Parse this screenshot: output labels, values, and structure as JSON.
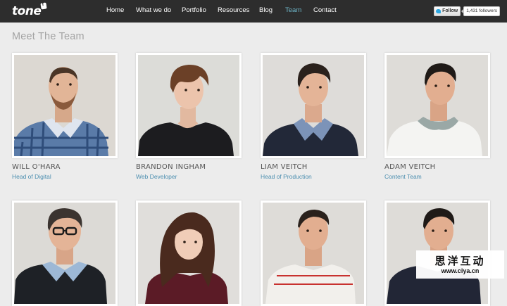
{
  "header": {
    "logo_text": "tone",
    "logo_mark": "f",
    "nav": [
      {
        "label": "Home",
        "active": false
      },
      {
        "label": "What we do",
        "active": false
      },
      {
        "label": "Portfolio",
        "active": false
      },
      {
        "label": "Resources",
        "active": false
      },
      {
        "label": "Blog",
        "active": false
      },
      {
        "label": "Team",
        "active": true
      },
      {
        "label": "Contact",
        "active": false
      }
    ],
    "twitter": {
      "follow_label": "Follow",
      "followers": "1,431 followers",
      "icon": "twitter-bird-icon"
    }
  },
  "page_title": "Meet The Team",
  "team": [
    {
      "name": "WILL O'HARA",
      "role": "Head of Digital"
    },
    {
      "name": "BRANDON INGHAM",
      "role": "Web Developer"
    },
    {
      "name": "LIAM VEITCH",
      "role": "Head of Production"
    },
    {
      "name": "ADAM VEITCH",
      "role": "Content Team"
    },
    {
      "name": "",
      "role": ""
    },
    {
      "name": "",
      "role": ""
    },
    {
      "name": "",
      "role": ""
    },
    {
      "name": "",
      "role": ""
    }
  ],
  "watermark": {
    "chinese": "思洋互动",
    "url": "www.ciya.cn"
  },
  "colors": {
    "topbar": "#2d2d2d",
    "active_nav": "#6fb6c9",
    "role_link": "#4d8fb0",
    "background": "#ececec"
  }
}
